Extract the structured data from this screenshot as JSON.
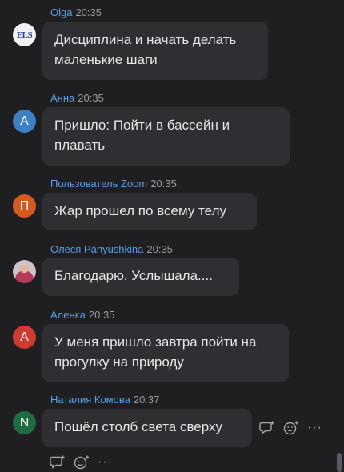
{
  "messages": [
    {
      "avatar_letter": "ELS",
      "avatar_color": "#f2f2f4",
      "name": "Olga",
      "time": "20:35",
      "text": "Дисциплина и начать делать\nмаленькие шаги"
    },
    {
      "avatar_letter": "А",
      "avatar_color": "#3d80c5",
      "name": "Анна",
      "time": "20:35",
      "text": "Пришло: Пойти в бассейн и\nплавать"
    },
    {
      "avatar_letter": "П",
      "avatar_color": "#d55a1f",
      "name": "Пользователь Zoom",
      "time": "20:35",
      "text": "Жар прошел по всему телу"
    },
    {
      "avatar_letter": "",
      "avatar_color": "#cfc2c6",
      "name": "Олеся Panyushkina",
      "time": "20:35",
      "text": "Благодарю.  Услышала...."
    },
    {
      "avatar_letter": "А",
      "avatar_color": "#cf3b2f",
      "name": "Аленка",
      "time": "20:35",
      "text": "У меня пришло завтра пойти на\nпрогулку на природу"
    },
    {
      "avatar_letter": "N",
      "avatar_color": "#1f6b45",
      "name": "Наталия Комова",
      "time": "20:37",
      "text": "Пошёл столб света сверху"
    }
  ],
  "actions": {
    "reply_icon": "reply-icon",
    "emoji_icon": "emoji-reaction-icon",
    "more_label": "···"
  }
}
